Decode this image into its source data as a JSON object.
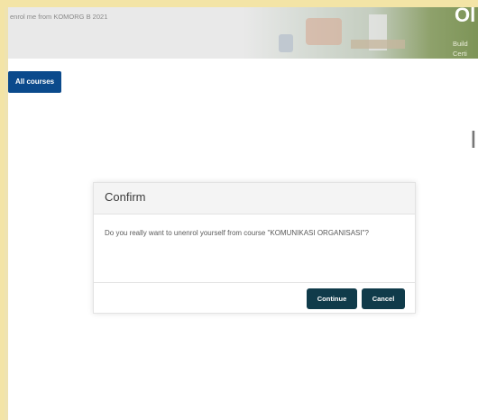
{
  "header": {
    "breadcrumb": "enrol me from KOMORG B 2021",
    "banner_title": "Ol",
    "banner_sub1": "Build",
    "banner_sub2": "Certi"
  },
  "nav": {
    "all_courses_label": "All courses"
  },
  "page": {
    "right_fragment": "I"
  },
  "modal": {
    "title": "Confirm",
    "message": "Do you really want to unenrol yourself from course \"KOMUNIKASI ORGANISASI\"?",
    "continue_label": "Continue",
    "cancel_label": "Cancel"
  },
  "colors": {
    "frame": "#f3e4a6",
    "primary_button": "#0b4a8c",
    "modal_button": "#103b4a"
  }
}
